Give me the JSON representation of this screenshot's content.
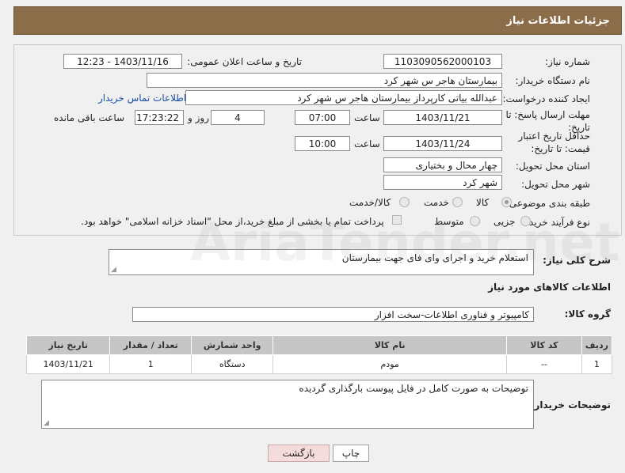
{
  "header": {
    "title": "جزئیات اطلاعات نیاز"
  },
  "fields": {
    "need_number": {
      "label": "شماره نیاز:",
      "value": "1103090562000103"
    },
    "announce_datetime": {
      "label": "تاریخ و ساعت اعلان عمومی:",
      "value": "1403/11/16 - 12:23"
    },
    "buyer_org": {
      "label": "نام دستگاه خریدار:",
      "value": "بیمارستان هاجر س  شهر کرد"
    },
    "requester": {
      "label": "ایجاد کننده درخواست:",
      "value": "عبدالله بیاتی کارپرداز بیمارستان هاجر س  شهر کرد"
    },
    "contact_link": "اطلاعات تماس خریدار",
    "reply_deadline": {
      "label": "مهلت ارسال پاسخ: تا تاریخ:",
      "date": "1403/11/21",
      "time_label": "ساعت",
      "time": "07:00",
      "days": "4",
      "days_label": "روز و",
      "remaining_time": "17:23:22",
      "remaining_label": "ساعت باقی مانده"
    },
    "price_validity": {
      "label": "حداقل تاریخ اعتبار قیمت: تا تاریخ:",
      "date": "1403/11/24",
      "time_label": "ساعت",
      "time": "10:00"
    },
    "delivery_province": {
      "label": "استان محل تحویل:",
      "value": "چهار محال و بختیاری"
    },
    "delivery_city": {
      "label": "شهر محل تحویل:",
      "value": "شهر کرد"
    },
    "category": {
      "label": "طبقه بندی موضوعی:",
      "options": [
        "کالا",
        "خدمت",
        "کالا/خدمت"
      ],
      "selected": "کالا"
    },
    "purchase_type": {
      "label": "نوع فرآیند خرید :",
      "options": [
        "جزیی",
        "متوسط"
      ],
      "payment_note": "پرداخت تمام یا بخشی از مبلغ خرید،از محل \"اسناد خزانه اسلامی\" خواهد بود."
    }
  },
  "description": {
    "label": "شرح کلی نیاز:",
    "value": "استعلام خرید و اجرای وای فای جهت بیمارستان"
  },
  "goods_section": {
    "title": "اطلاعات کالاهای مورد نیاز"
  },
  "goods_group": {
    "label": "گروه کالا:",
    "value": "کامپیوتر و فناوری اطلاعات-سخت افزار"
  },
  "table": {
    "headers": [
      "ردیف",
      "کد کالا",
      "نام کالا",
      "واحد شمارش",
      "تعداد / مقدار",
      "تاریخ نیاز"
    ],
    "rows": [
      [
        "1",
        "--",
        "مودم",
        "دستگاه",
        "1",
        "1403/11/21"
      ]
    ]
  },
  "buyer_notes": {
    "label": "توضیحات خریدار:",
    "value": "توضیحات به صورت کامل در فایل پیوست بارگذاری گردیده"
  },
  "buttons": {
    "print": "چاپ",
    "back": "بازگشت"
  },
  "watermark": "AriaTender.net"
}
